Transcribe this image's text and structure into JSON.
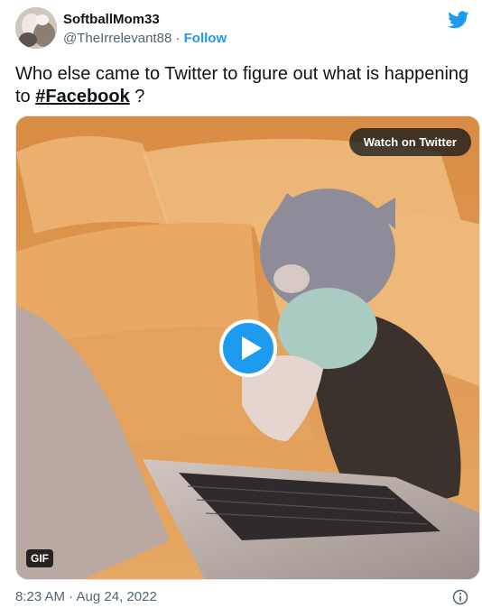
{
  "author": {
    "display_name": "SoftballMom33",
    "handle": "@TheIrrelevant88",
    "separator": " · ",
    "follow_label": "Follow"
  },
  "tweet": {
    "text_before": "Who else came to Twitter to figure out what is happening to ",
    "hashtag": "#Facebook",
    "text_after": " ?",
    "timestamp": "8:23 AM · Aug 24, 2022"
  },
  "media": {
    "watch_label": "Watch on Twitter",
    "gif_badge": "GIF",
    "play_icon": "play-icon"
  },
  "colors": {
    "twitter_blue": "#1d9bf0",
    "text_primary": "#0f1419",
    "text_secondary": "#536471"
  },
  "icons": {
    "brand": "twitter-bird-icon",
    "info": "info-icon"
  }
}
